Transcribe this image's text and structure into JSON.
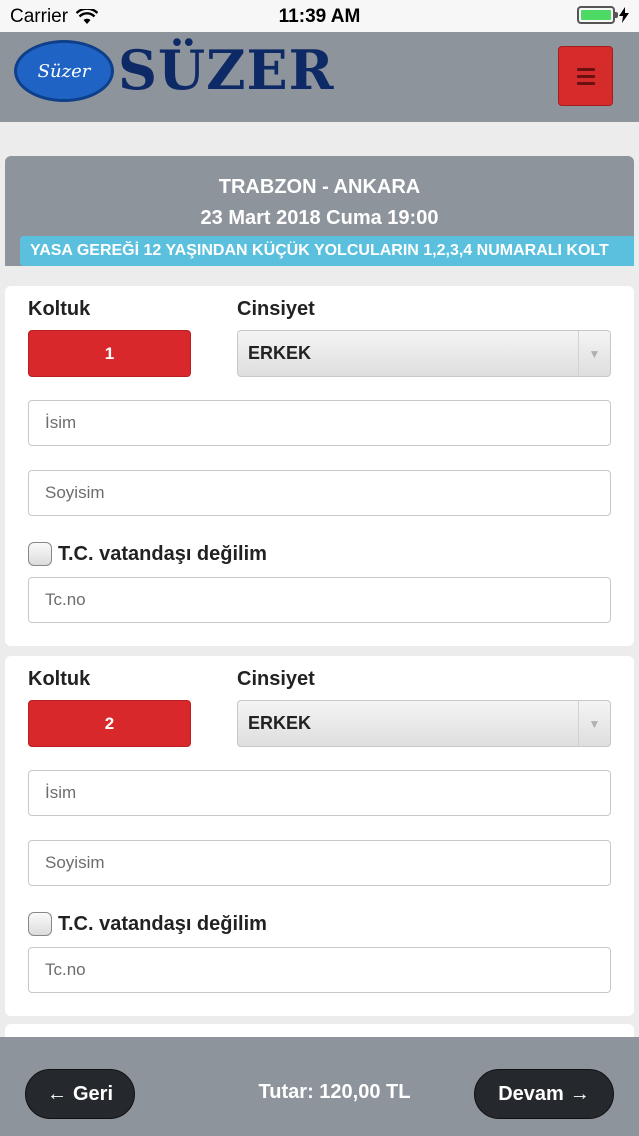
{
  "status_bar": {
    "carrier": "Carrier",
    "time": "11:39 AM",
    "battery_level": 1.0
  },
  "header": {
    "logo_oval_text": "Süzer",
    "logo_text": "SÜZER",
    "menu_icon": "hamburger-icon"
  },
  "trip": {
    "route": "TRABZON - ANKARA",
    "date": "23 Mart 2018 Cuma 19:00",
    "notice": "YASA GEREĞİ 12 YAŞINDAN KÜÇÜK YOLCULARIN 1,2,3,4 NUMARALI KOLT"
  },
  "passengers": [
    {
      "seat_label": "Koltuk",
      "seat_number": "1",
      "gender_label": "Cinsiyet",
      "gender_value": "ERKEK",
      "name_placeholder": "İsim",
      "surname_placeholder": "Soyisim",
      "not_citizen_label": "T.C. vatandaşı değilim",
      "tc_placeholder": "Tc.no"
    },
    {
      "seat_label": "Koltuk",
      "seat_number": "2",
      "gender_label": "Cinsiyet",
      "gender_value": "ERKEK",
      "name_placeholder": "İsim",
      "surname_placeholder": "Soyisim",
      "not_citizen_label": "T.C. vatandaşı değilim",
      "tc_placeholder": "Tc.no"
    }
  ],
  "footer": {
    "back_arrow": "←",
    "back_label": "Geri",
    "total": "Tutar: 120,00 TL",
    "next_label": "Devam",
    "next_arrow": "→"
  },
  "colors": {
    "header_bg": "#8e949c",
    "seat_button": "#d9282b",
    "notice_bg": "#5bc0de",
    "footer_button": "#25282c",
    "battery": "#4cd964"
  }
}
